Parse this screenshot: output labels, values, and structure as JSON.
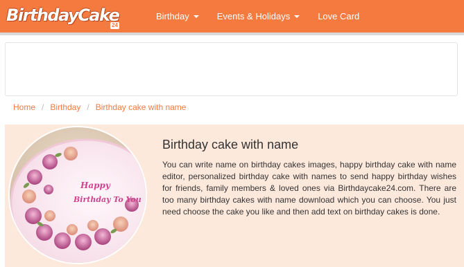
{
  "header": {
    "logo_text": "BirthdayCake",
    "logo_badge": "24",
    "nav": [
      {
        "label": "Birthday",
        "has_dropdown": true
      },
      {
        "label": "Events & Holidays",
        "has_dropdown": true
      },
      {
        "label": "Love Card",
        "has_dropdown": false
      }
    ]
  },
  "breadcrumb": {
    "items": [
      "Home",
      "Birthday",
      "Birthday cake with name"
    ],
    "separator": "/"
  },
  "article": {
    "title": "Birthday cake with name",
    "description": "You can write name on birthday cakes images, happy birthday cake with name editor, personalized birthday cake with names to send happy birthday wishes for friends, family members & loved ones via Birthdaycake24.com. There are too many birthday cakes with name download which you can choose. You just need choose the cake you like and then add text on birthday cakes is done.",
    "image_text": "Happy Birthday To You"
  },
  "colors": {
    "brand": "#f47a3f",
    "panel_bg": "#fde8dc",
    "text": "#333333"
  }
}
